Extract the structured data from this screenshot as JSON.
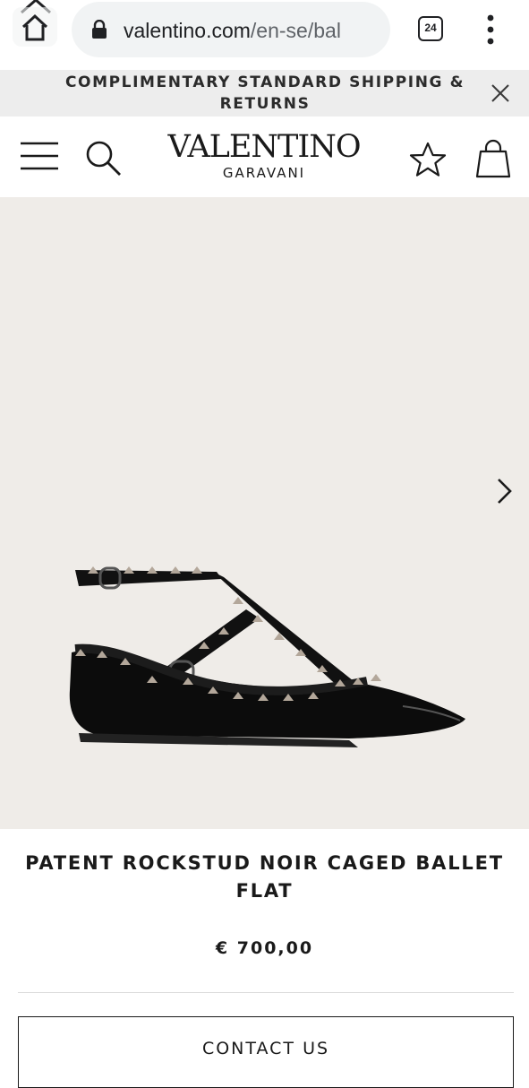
{
  "browser": {
    "url_host": "valentino.com",
    "url_path": "/en-se/bal",
    "tab_count": "24",
    "icons": {
      "home": "home-icon",
      "lock": "lock-icon",
      "menu": "more-vert-icon",
      "collapse": "chevron-up-icon"
    }
  },
  "promo": {
    "text": "COMPLIMENTARY STANDARD SHIPPING & RETURNS",
    "close_icon": "close-icon"
  },
  "header": {
    "logo_main": "VALENTINO",
    "logo_sub": "GARAVANI",
    "icons": [
      "hamburger-menu-icon",
      "search-icon",
      "star-icon",
      "shopping-bag-icon"
    ]
  },
  "gallery": {
    "background": "#efece8",
    "next_icon": "chevron-right-icon"
  },
  "product": {
    "title": "PATENT ROCKSTUD NOIR CAGED BALLET FLAT",
    "price": "€ 700,00"
  },
  "actions": {
    "contact_label": "CONTACT US"
  }
}
